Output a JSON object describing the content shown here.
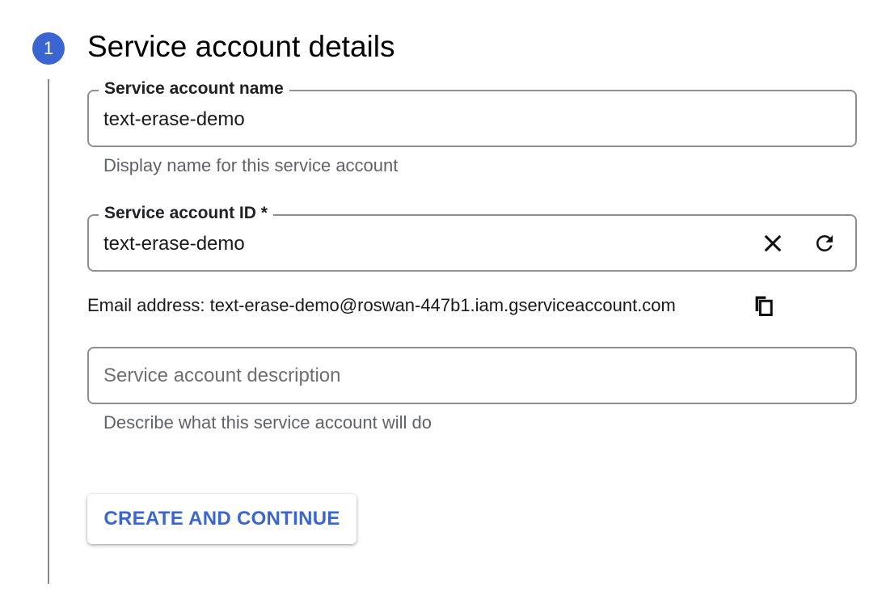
{
  "step": {
    "number": "1",
    "title": "Service account details"
  },
  "name_field": {
    "label": "Service account name",
    "value": "text-erase-demo",
    "helper": "Display name for this service account"
  },
  "id_field": {
    "label": "Service account ID *",
    "value": "text-erase-demo",
    "clear_icon": "close-icon",
    "refresh_icon": "refresh-icon"
  },
  "email": {
    "text": "Email address: text-erase-demo@roswan-447b1.iam.gserviceaccount.com",
    "copy_icon": "copy-icon"
  },
  "description_field": {
    "placeholder": "Service account description",
    "value": "",
    "helper": "Describe what this service account will do"
  },
  "actions": {
    "create_label": "CREATE AND CONTINUE"
  },
  "colors": {
    "accent": "#3b66d1",
    "border": "#8f8f8f",
    "helper_text": "#5f6368"
  }
}
